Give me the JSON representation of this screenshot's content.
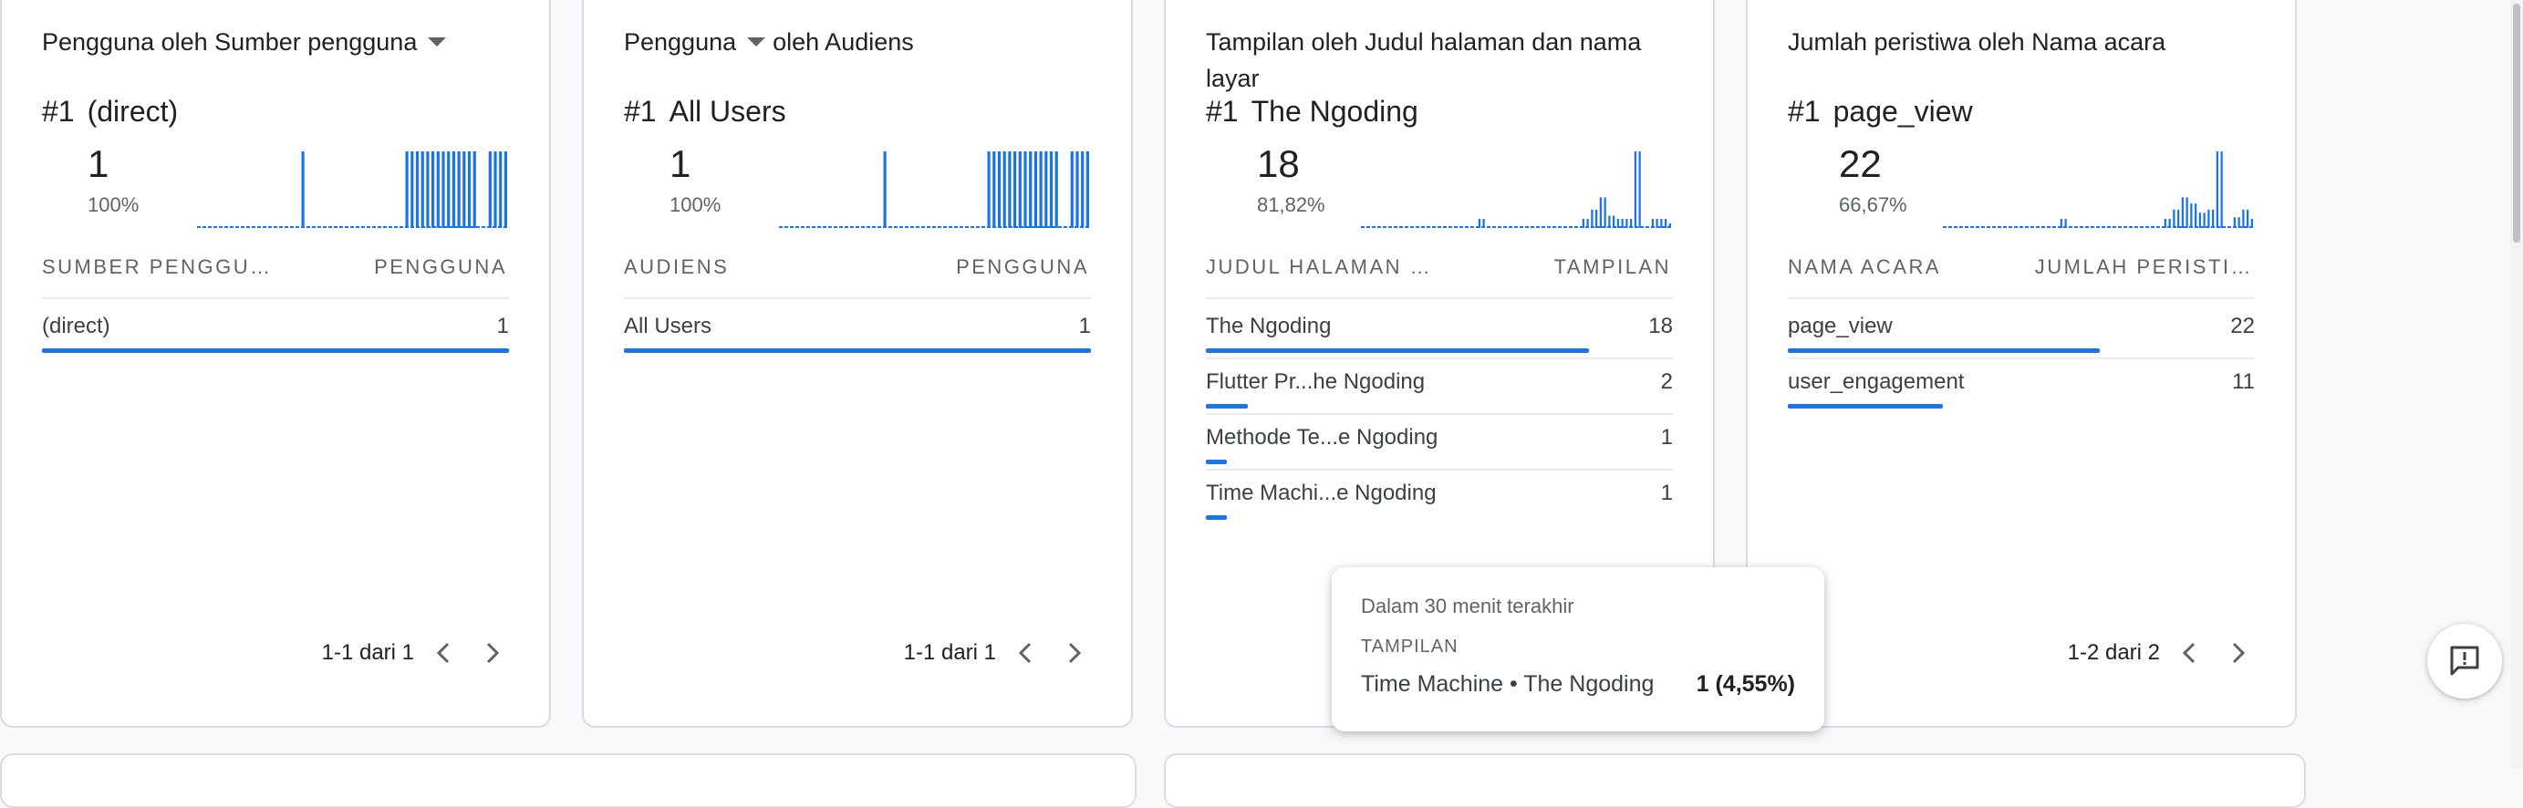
{
  "accent_color": "#1a73e8",
  "cards": [
    {
      "title_parts": [
        "Pengguna oleh Sumber pengguna"
      ],
      "title_dropdown_after": 0,
      "rank_num": "#1",
      "rank_label": "(direct)",
      "big_value": "1",
      "percent": "100%",
      "spark": [
        0,
        0,
        0,
        0,
        0,
        0,
        0,
        0,
        0,
        0,
        0,
        0,
        0,
        0,
        0,
        0,
        0,
        0,
        0,
        0,
        1,
        0,
        0,
        0,
        0,
        0,
        0,
        0,
        0,
        0,
        0,
        0,
        0,
        0,
        0,
        0,
        0,
        0,
        0,
        0,
        1,
        1,
        1,
        1,
        1,
        1,
        1,
        1,
        1,
        1,
        1,
        1,
        1,
        1,
        0,
        0,
        1,
        1,
        1,
        1
      ],
      "col_left": "SUMBER PENGGU…",
      "col_right": "PENGGUNA",
      "rows": [
        {
          "label": "(direct)",
          "value": "1",
          "fraction": 1.0
        }
      ],
      "pager": "1-1 dari 1"
    },
    {
      "title_parts": [
        "Pengguna",
        "oleh Audiens"
      ],
      "title_dropdown_after": 0,
      "rank_num": "#1",
      "rank_label": "All Users",
      "big_value": "1",
      "percent": "100%",
      "spark": [
        0,
        0,
        0,
        0,
        0,
        0,
        0,
        0,
        0,
        0,
        0,
        0,
        0,
        0,
        0,
        0,
        0,
        0,
        0,
        0,
        1,
        0,
        0,
        0,
        0,
        0,
        0,
        0,
        0,
        0,
        0,
        0,
        0,
        0,
        0,
        0,
        0,
        0,
        0,
        0,
        1,
        1,
        1,
        1,
        1,
        1,
        1,
        1,
        1,
        1,
        1,
        1,
        1,
        1,
        0,
        0,
        1,
        1,
        1,
        1
      ],
      "col_left": "AUDIENS",
      "col_right": "PENGGUNA",
      "rows": [
        {
          "label": "All Users",
          "value": "1",
          "fraction": 1.0
        }
      ],
      "pager": "1-1 dari 1"
    },
    {
      "title_parts": [
        "Tampilan oleh Judul halaman dan nama layar"
      ],
      "title_dropdown_after": -1,
      "rank_num": "#1",
      "rank_label": "The Ngoding",
      "big_value": "18",
      "percent": "81,82%",
      "spark": [
        0,
        0,
        0,
        0,
        0,
        0,
        0,
        0,
        0,
        0,
        0,
        0,
        0,
        0,
        0,
        0,
        0,
        0,
        0,
        0,
        0,
        0,
        0,
        0,
        0,
        0,
        0,
        0.12,
        0.12,
        0,
        0,
        0,
        0,
        0,
        0,
        0,
        0,
        0,
        0,
        0,
        0,
        0,
        0,
        0,
        0,
        0,
        0,
        0,
        0,
        0,
        0,
        0.12,
        0.12,
        0.24,
        0.24,
        0.4,
        0.4,
        0.16,
        0.16,
        0.12,
        0.12,
        0.12,
        0.12,
        1,
        1,
        0,
        0,
        0.12,
        0.12,
        0.12,
        0.12,
        0.06
      ],
      "col_left": "JUDUL HALAMAN …",
      "col_right": "TAMPILAN",
      "rows": [
        {
          "label": "The Ngoding",
          "value": "18",
          "fraction": 0.82
        },
        {
          "label": "Flutter Pr...he Ngoding",
          "value": "2",
          "fraction": 0.09
        },
        {
          "label": "Methode Te...e Ngoding",
          "value": "1",
          "fraction": 0.045
        },
        {
          "label": "Time Machi...e Ngoding",
          "value": "1",
          "fraction": 0.045
        }
      ],
      "pager": ""
    },
    {
      "title_parts": [
        "Jumlah peristiwa oleh Nama acara"
      ],
      "title_dropdown_after": -1,
      "rank_num": "#1",
      "rank_label": "page_view",
      "big_value": "22",
      "percent": "66,67%",
      "spark": [
        0,
        0,
        0,
        0,
        0,
        0,
        0,
        0,
        0,
        0,
        0,
        0,
        0,
        0,
        0,
        0,
        0,
        0,
        0,
        0,
        0,
        0,
        0,
        0,
        0,
        0,
        0,
        0.12,
        0.12,
        0,
        0,
        0,
        0,
        0,
        0,
        0,
        0,
        0,
        0,
        0,
        0,
        0,
        0,
        0,
        0,
        0,
        0,
        0,
        0,
        0,
        0,
        0.12,
        0.12,
        0.24,
        0.24,
        0.4,
        0.4,
        0.32,
        0.32,
        0.2,
        0.2,
        0.24,
        0.24,
        1,
        1,
        0,
        0,
        0.14,
        0.14,
        0.24,
        0.24,
        0.12
      ],
      "col_left": "NAMA ACARA",
      "col_right": "JUMLAH PERISTI…",
      "rows": [
        {
          "label": "page_view",
          "value": "22",
          "fraction": 0.667
        },
        {
          "label": "user_engagement",
          "value": "11",
          "fraction": 0.333
        }
      ],
      "pager": "1-2 dari 2"
    }
  ],
  "tooltip": {
    "time": "Dalam 30 menit terakhir",
    "metric": "TAMPILAN",
    "item": "Time Machine • The Ngoding",
    "value": "1 (4,55%)"
  },
  "icons": {
    "prev": "chevron-left-icon",
    "next": "chevron-right-icon",
    "feedback": "feedback-icon",
    "dropdown": "dropdown-caret-icon"
  }
}
